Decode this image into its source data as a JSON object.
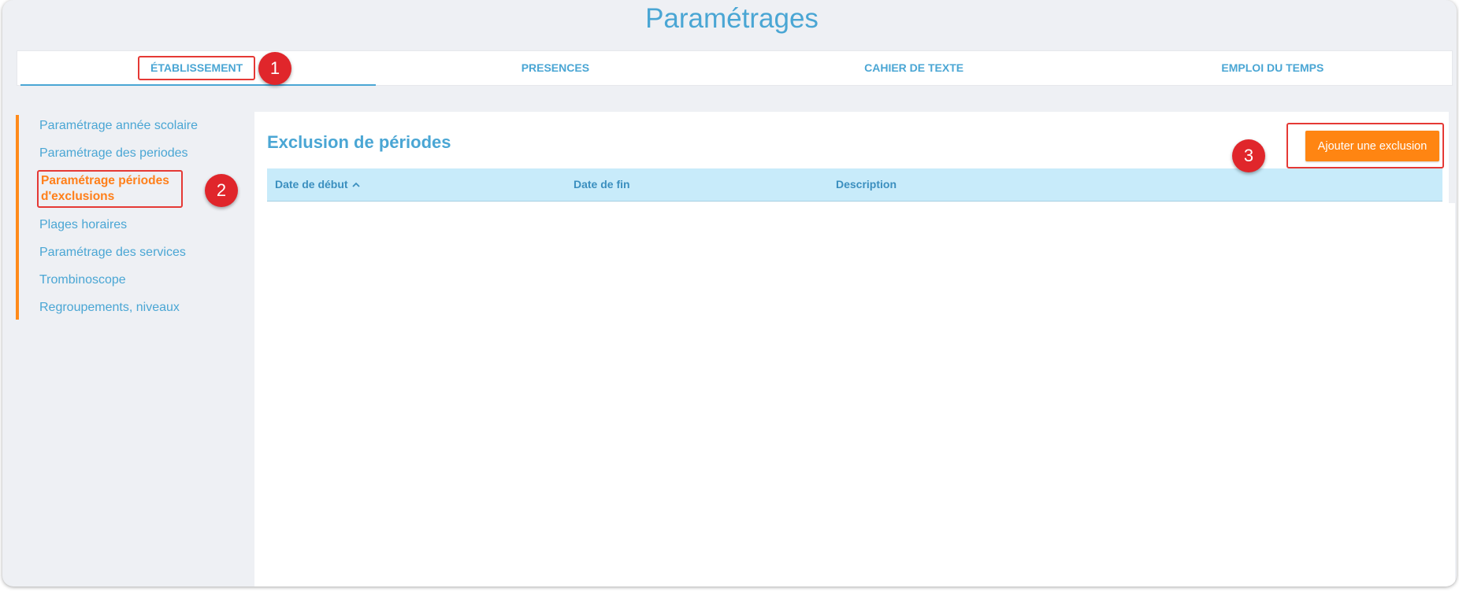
{
  "header": {
    "title": "Paramétrages"
  },
  "tabs": [
    {
      "label": "ÉTABLISSEMENT"
    },
    {
      "label": "PRESENCES"
    },
    {
      "label": "CAHIER DE TEXTE"
    },
    {
      "label": "EMPLOI DU TEMPS"
    }
  ],
  "sidebar": {
    "items": [
      {
        "label": "Paramétrage année scolaire"
      },
      {
        "label": "Paramétrage des periodes"
      },
      {
        "label": "Paramétrage périodes d'exclusions"
      },
      {
        "label": "Plages horaires"
      },
      {
        "label": "Paramétrage des services"
      },
      {
        "label": "Trombinoscope"
      },
      {
        "label": "Regroupements, niveaux"
      }
    ]
  },
  "main": {
    "title": "Exclusion de périodes",
    "add_button": "Ajouter une exclusion",
    "table": {
      "columns": [
        "Date de début",
        "Date de fin",
        "Description"
      ],
      "rows": []
    }
  },
  "annotations": [
    "1",
    "2",
    "3"
  ],
  "colors": {
    "accent": "#4aa6d4",
    "active": "#ff7f1a",
    "button": "#ff8512",
    "marker": "#e0262b",
    "table_header": "#c8ebfa"
  },
  "icons": {
    "sort": "chevron-up-icon"
  }
}
